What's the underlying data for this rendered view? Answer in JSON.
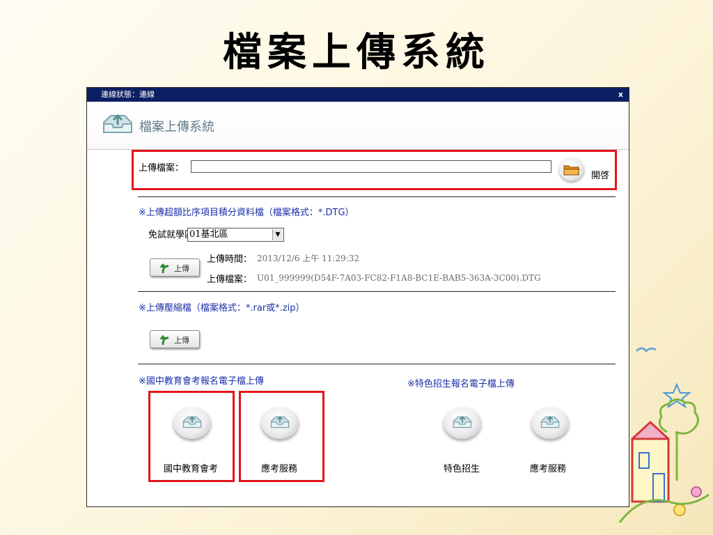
{
  "slide": {
    "title": "檔案上傳系統"
  },
  "window": {
    "status_text": "連線狀態：連線",
    "close_label": "x",
    "app_name": "檔案上傳系統"
  },
  "file_picker": {
    "label": "上傳檔案：",
    "value": "",
    "open_label": "開啓"
  },
  "score_upload": {
    "heading": "※上傳超額比序項目積分資料檔（檔案格式：*.DTG）",
    "district_label": "免試就學區",
    "district_selected": "01基北區",
    "upload_label": "上傳",
    "time_label": "上傳時間：",
    "time_value": "2013/12/6 上午 11:29:32",
    "file_label": "上傳檔案：",
    "file_value": "U01_999999(D54F-7A03-FC82-F1A8-BC1E-BAB5-363A-3C00).DTG"
  },
  "zip_upload": {
    "heading": "※上傳壓縮檔（檔案格式：*.rar或*.zip）",
    "upload_label": "上傳"
  },
  "junior_exam": {
    "heading": "※國中教育會考報名電子檔上傳",
    "buttons": [
      {
        "label": "國中教育會考"
      },
      {
        "label": "應考服務"
      }
    ]
  },
  "special_admission": {
    "heading": "※特色招生報名電子檔上傳",
    "buttons": [
      {
        "label": "特色招生"
      },
      {
        "label": "應考服務"
      }
    ]
  },
  "colors": {
    "titlebar": "#0c1f63",
    "highlight": "#e2141b",
    "link_blue": "#1a2fa8"
  }
}
